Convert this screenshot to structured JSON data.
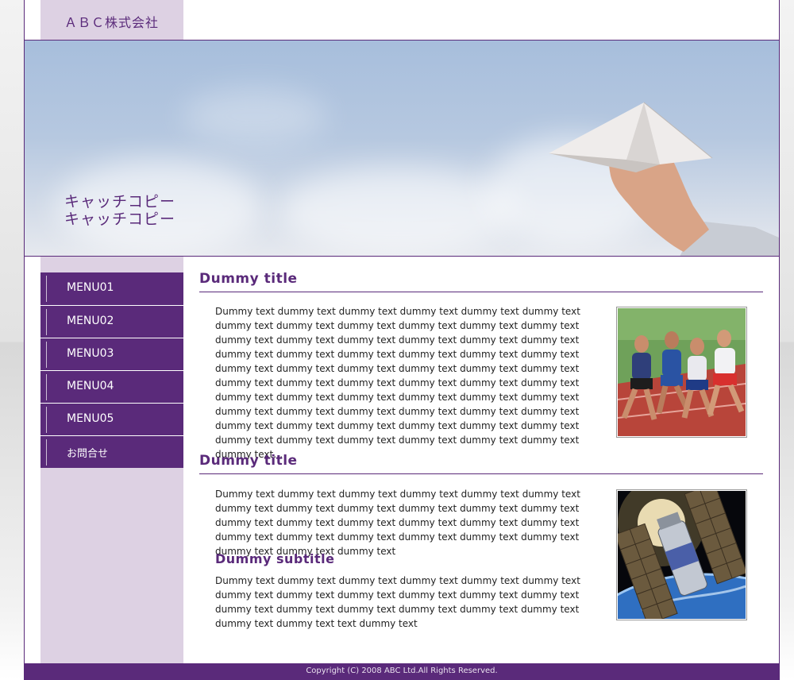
{
  "header": {
    "company_name": "ＡＢＣ株式会社"
  },
  "hero": {
    "catch_line1": "キャッチコピー",
    "catch_line2": "キャッチコピー"
  },
  "sidebar": {
    "items": [
      {
        "label": "MENU01"
      },
      {
        "label": "MENU02"
      },
      {
        "label": "MENU03"
      },
      {
        "label": "MENU04"
      },
      {
        "label": "MENU05"
      },
      {
        "label": "お問合せ"
      }
    ]
  },
  "sections": [
    {
      "title": "Dummy title",
      "paragraph": "Dummy text dummy text  dummy text  dummy text  dummy text  dummy text  dummy text  dummy text  dummy text dummy text  dummy text  dummy text  dummy text dummy text  dummy text  dummy text  dummy text  dummy text dummy text  dummy text dummy text  dummy text  dummy text  dummy text  dummy text  dummy text  dummy text dummy text  dummy text  dummy text  dummy text  dummy text  dummy text  dummy text  dummy text  dummy text dummy text  dummy text  dummy text  dummy text  dummy text  dummy text  dummy text  dummy text dummy text  dummy text  dummy text  dummy text  dummy text  dummy text  dummy text  dummy text   dummy text  dummy text  dummy text dummy text  dummy text  dummy text  dummy text  dummy text  dummy text…"
    },
    {
      "title": "Dummy title",
      "paragraph": "Dummy text dummy text  dummy text  dummy text  dummy text  dummy text  dummy text  dummy text  dummy text dummy text  dummy text  dummy text  dummy text dummy text  dummy text  dummy text  dummy text dummy text  dummy text  dummy text  dummy text  dummy text  dummy text  dummy text  dummy text  dummy text dummy text",
      "subtitle": "Dummy subtitle",
      "paragraph2": "Dummy text dummy text  dummy text  dummy text  dummy text  dummy text  dummy text  dummy text  dummy text dummy text  dummy text  dummy text  dummy text dummy text  dummy text  dummy text  dummy text  dummy text  dummy text dummy text  text  dummy text"
    }
  ],
  "footer": {
    "copyright": "Copyright (C) 2008 ABC Ltd.All Rights Reserved."
  },
  "colors": {
    "brand_purple": "#5a2a7a",
    "light_lavender": "#ddd1e3"
  }
}
